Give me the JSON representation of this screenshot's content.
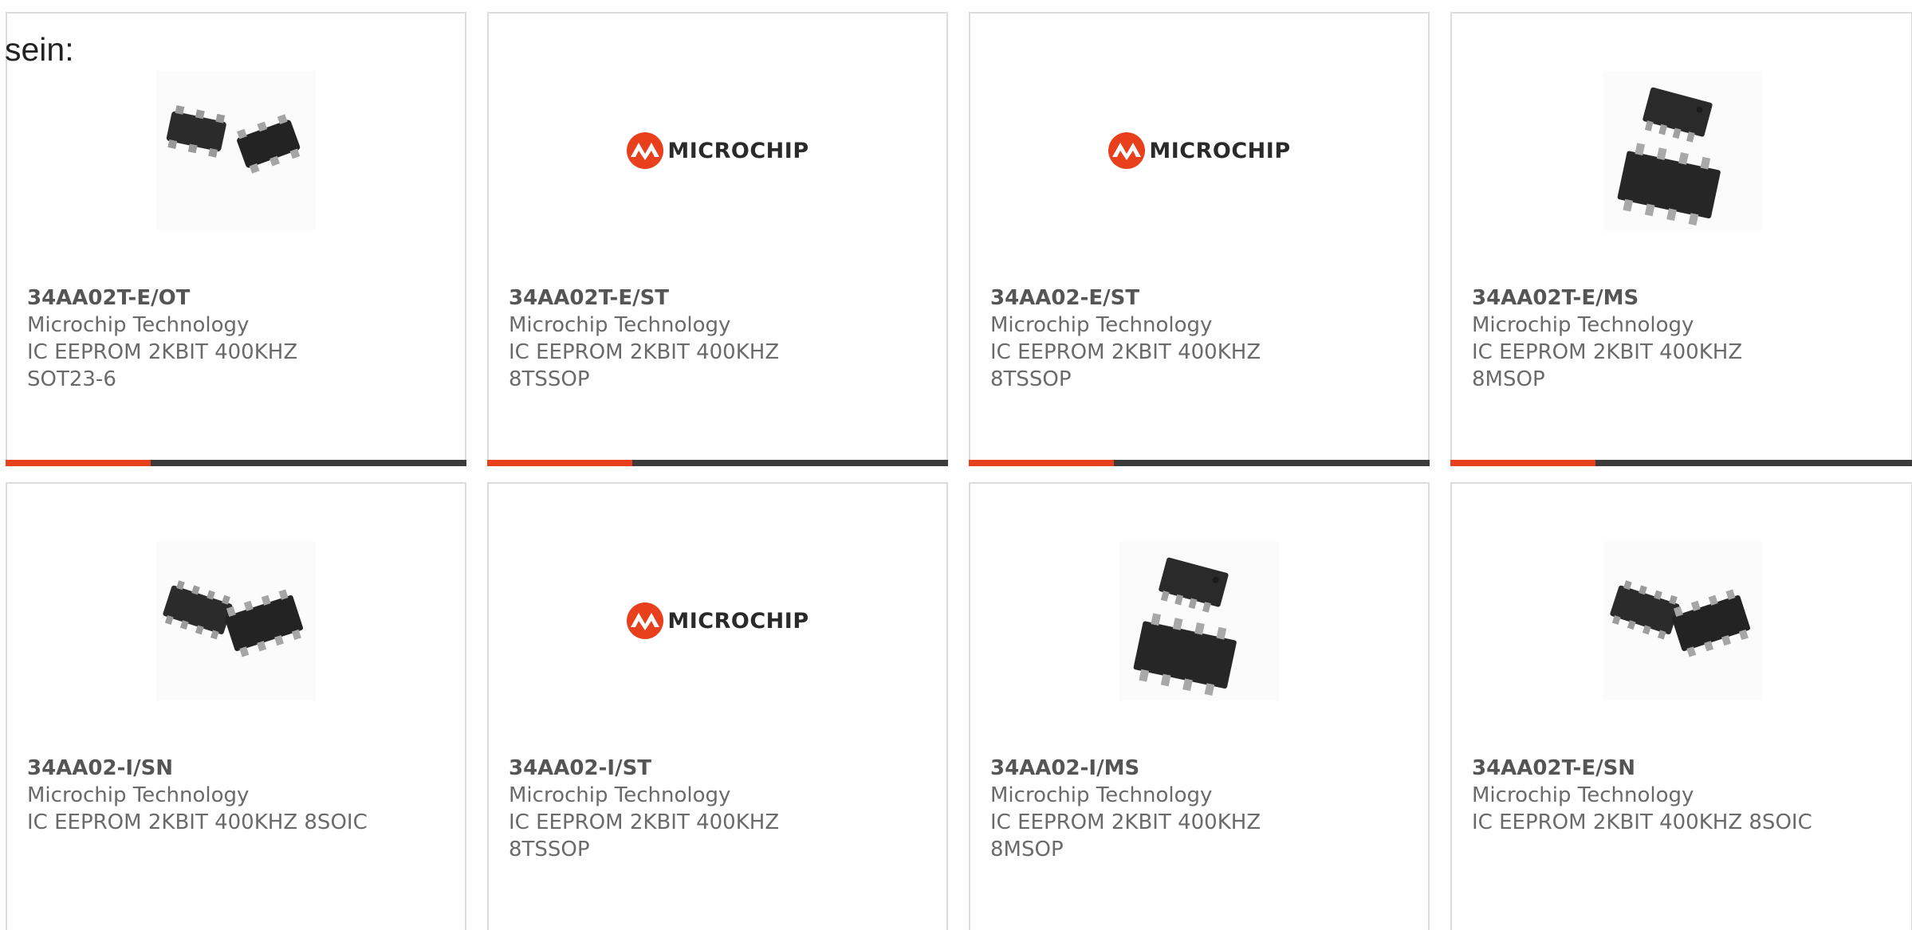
{
  "intro_text": "sein:",
  "logo_text": "MICROCHIP",
  "colors": {
    "accent": "#e8401c",
    "bar_dark": "#3b3b3b",
    "text_gray": "#6a6a6a"
  },
  "products": [
    {
      "part": "34AA02T-E/OT",
      "manufacturer": "Microchip Technology",
      "desc_line1": "IC EEPROM 2KBIT 400KHZ",
      "desc_line2": "SOT23-6",
      "image": "sot23-6-chip-photo"
    },
    {
      "part": "34AA02T-E/ST",
      "manufacturer": "Microchip Technology",
      "desc_line1": "IC EEPROM 2KBIT 400KHZ",
      "desc_line2": "8TSSOP",
      "image": "microchip-logo"
    },
    {
      "part": "34AA02-E/ST",
      "manufacturer": "Microchip Technology",
      "desc_line1": "IC EEPROM 2KBIT 400KHZ",
      "desc_line2": "8TSSOP",
      "image": "microchip-logo"
    },
    {
      "part": "34AA02T-E/MS",
      "manufacturer": "Microchip Technology",
      "desc_line1": "IC EEPROM 2KBIT 400KHZ",
      "desc_line2": "8MSOP",
      "image": "msop-chip-photo"
    },
    {
      "part": "34AA02-I/SN",
      "manufacturer": "Microchip Technology",
      "desc_line1": "IC EEPROM 2KBIT 400KHZ 8SOIC",
      "desc_line2": "",
      "image": "soic-chip-photo"
    },
    {
      "part": "34AA02-I/ST",
      "manufacturer": "Microchip Technology",
      "desc_line1": "IC EEPROM 2KBIT 400KHZ",
      "desc_line2": "8TSSOP",
      "image": "microchip-logo"
    },
    {
      "part": "34AA02-I/MS",
      "manufacturer": "Microchip Technology",
      "desc_line1": "IC EEPROM 2KBIT 400KHZ",
      "desc_line2": "8MSOP",
      "image": "msop-chip-photo"
    },
    {
      "part": "34AA02T-E/SN",
      "manufacturer": "Microchip Technology",
      "desc_line1": "IC EEPROM 2KBIT 400KHZ 8SOIC",
      "desc_line2": "",
      "image": "soic-chip-photo"
    }
  ]
}
